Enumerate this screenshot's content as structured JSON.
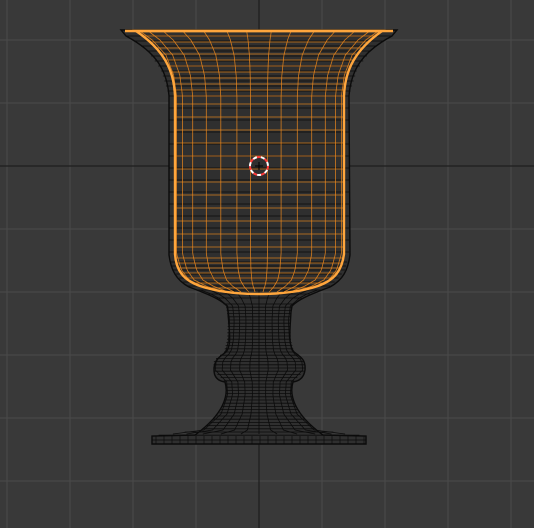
{
  "viewport": {
    "view": "front-orthographic",
    "background_color": "#393939",
    "grid_minor_color": "#434343",
    "grid_major_color": "#4a4a4a",
    "axis_color": "#1e1e1e",
    "wire_color": "#0b0b0b",
    "selected_color": "#f08a1c",
    "selected_edge_color": "#ffa63d",
    "cursor_colors": [
      "#ff3a3a",
      "#ffffff"
    ]
  },
  "object": {
    "name_icon": "goblet-mesh",
    "selected_part": "cup-inner-surface",
    "center_icon": "3d-cursor-icon"
  }
}
